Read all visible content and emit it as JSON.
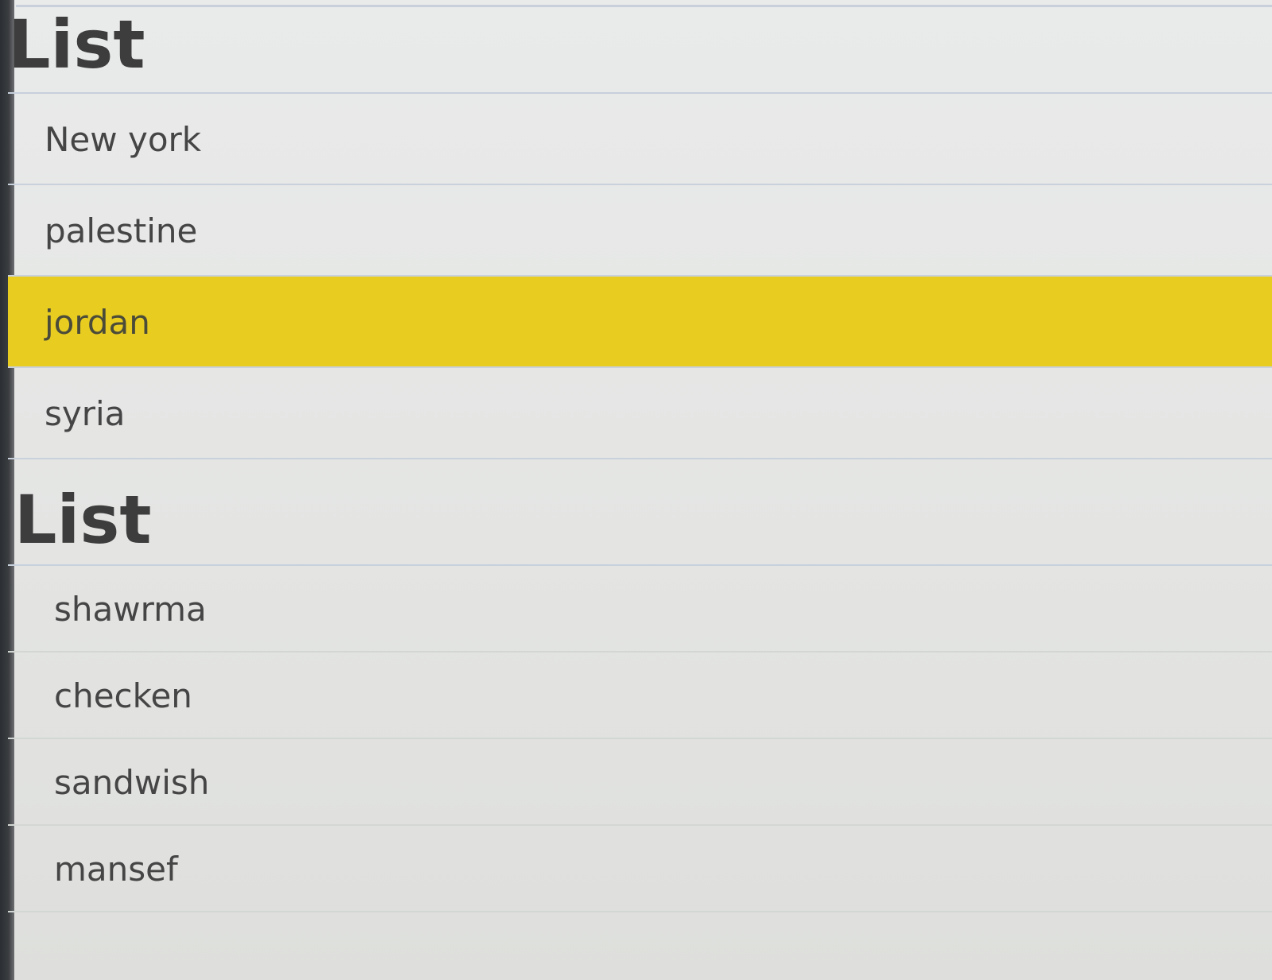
{
  "lists": [
    {
      "heading": "List",
      "items": [
        {
          "label": "New york"
        },
        {
          "label": "palestine"
        },
        {
          "label": "jordan",
          "highlighted": true
        },
        {
          "label": "syria"
        }
      ]
    },
    {
      "heading": "List",
      "items": [
        {
          "label": "shawrma"
        },
        {
          "label": "checken"
        },
        {
          "label": "sandwish"
        },
        {
          "label": "mansef"
        }
      ]
    }
  ],
  "colors": {
    "highlight": "#e8cd20",
    "divider": "#c9d1dc",
    "background": "#e6e7e5",
    "text": "#454545"
  }
}
